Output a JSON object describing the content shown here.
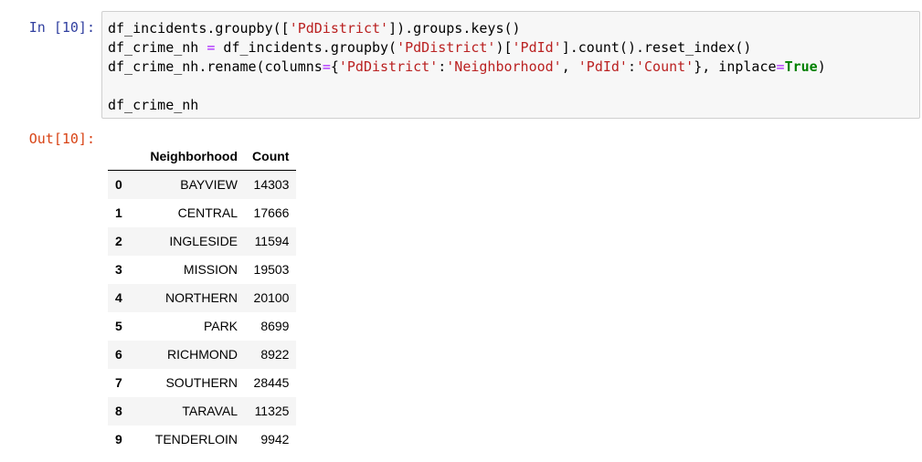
{
  "cell": {
    "in_prompt": "In [10]:",
    "out_prompt": "Out[10]:",
    "code_lines": [
      [
        {
          "t": "df_incidents.groupby(["
        },
        {
          "t": "'PdDistrict'",
          "c": "str"
        },
        {
          "t": "]).groups.keys()"
        }
      ],
      [
        {
          "t": "df_crime_nh "
        },
        {
          "t": "=",
          "c": "op"
        },
        {
          "t": " df_incidents.groupby("
        },
        {
          "t": "'PdDistrict'",
          "c": "str"
        },
        {
          "t": ")["
        },
        {
          "t": "'PdId'",
          "c": "str"
        },
        {
          "t": "].count().reset_index()"
        }
      ],
      [
        {
          "t": "df_crime_nh.rename(columns"
        },
        {
          "t": "=",
          "c": "op"
        },
        {
          "t": "{"
        },
        {
          "t": "'PdDistrict'",
          "c": "str"
        },
        {
          "t": ":"
        },
        {
          "t": "'Neighborhood'",
          "c": "str"
        },
        {
          "t": ", "
        },
        {
          "t": "'PdId'",
          "c": "str"
        },
        {
          "t": ":"
        },
        {
          "t": "'Count'",
          "c": "str"
        },
        {
          "t": "}, inplace"
        },
        {
          "t": "=",
          "c": "op"
        },
        {
          "t": "True",
          "c": "kw"
        },
        {
          "t": ")"
        }
      ],
      [],
      [
        {
          "t": "df_crime_nh"
        }
      ]
    ]
  },
  "table": {
    "columns": [
      "",
      "Neighborhood",
      "Count"
    ],
    "rows": [
      {
        "index": "0",
        "neighborhood": "BAYVIEW",
        "count": "14303"
      },
      {
        "index": "1",
        "neighborhood": "CENTRAL",
        "count": "17666"
      },
      {
        "index": "2",
        "neighborhood": "INGLESIDE",
        "count": "11594"
      },
      {
        "index": "3",
        "neighborhood": "MISSION",
        "count": "19503"
      },
      {
        "index": "4",
        "neighborhood": "NORTHERN",
        "count": "20100"
      },
      {
        "index": "5",
        "neighborhood": "PARK",
        "count": "8699"
      },
      {
        "index": "6",
        "neighborhood": "RICHMOND",
        "count": "8922"
      },
      {
        "index": "7",
        "neighborhood": "SOUTHERN",
        "count": "28445"
      },
      {
        "index": "8",
        "neighborhood": "TARAVAL",
        "count": "11325"
      },
      {
        "index": "9",
        "neighborhood": "TENDERLOIN",
        "count": "9942"
      }
    ]
  }
}
